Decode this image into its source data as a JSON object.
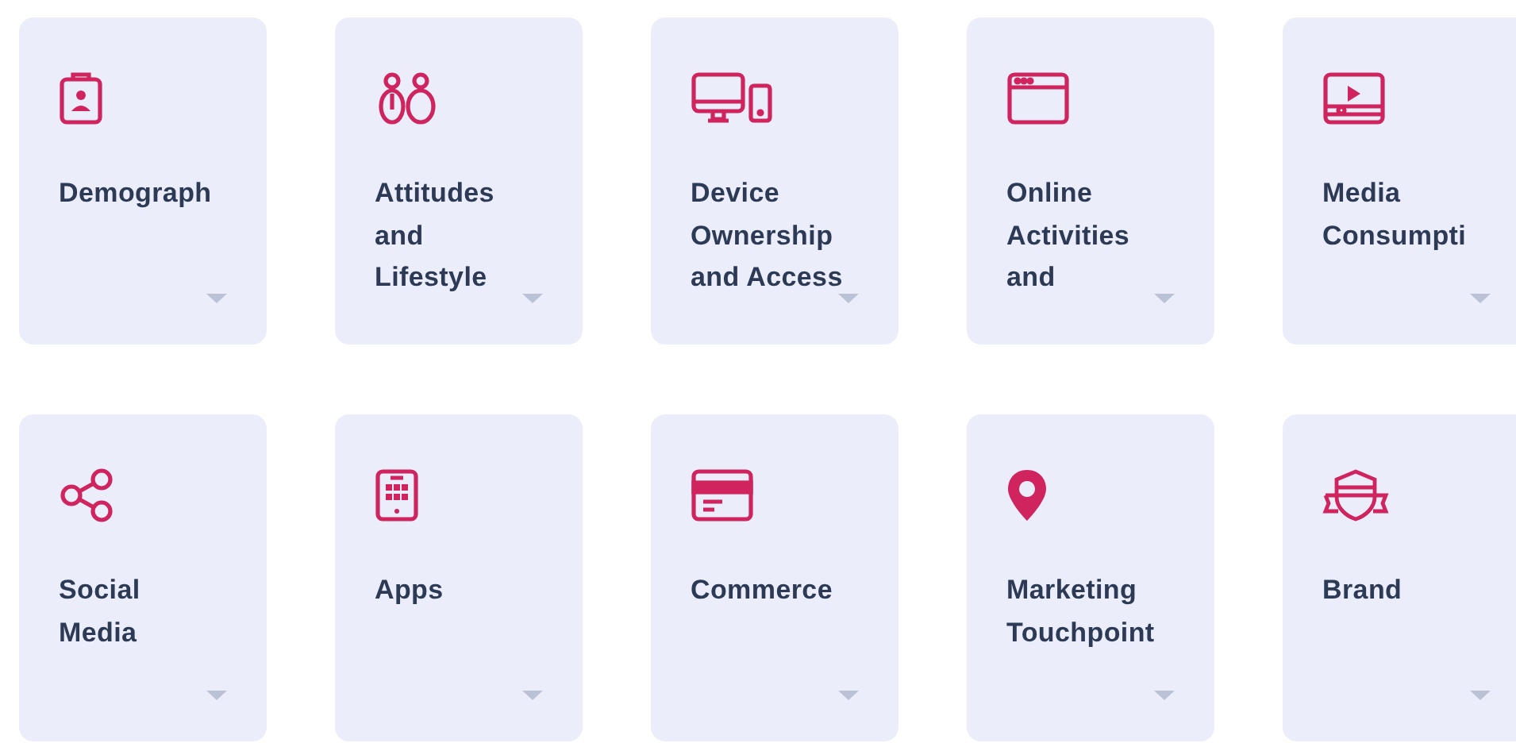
{
  "categories": [
    {
      "title": "Demograph"
    },
    {
      "title": "Attitudes and Lifestyle"
    },
    {
      "title": "Device Ownership and Access"
    },
    {
      "title": "Online Activities and"
    },
    {
      "title": "Media Consumpti"
    },
    {
      "title": "Social Media"
    },
    {
      "title": "Apps"
    },
    {
      "title": "Commerce"
    },
    {
      "title": "Marketing Touchpoint"
    },
    {
      "title": "Brand"
    }
  ]
}
